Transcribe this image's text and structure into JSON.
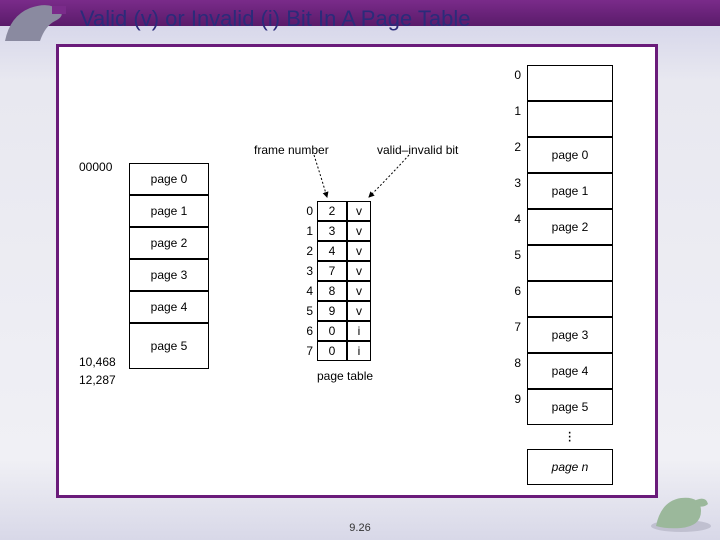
{
  "title": "Valid (v) or Invalid (i) Bit In A Page Table",
  "footer": "9.26",
  "labels": {
    "addr0": "00000",
    "addr1": "10,468",
    "addr2": "12,287",
    "frame_number": "frame number",
    "valid_invalid": "valid–invalid bit",
    "page_table": "page table"
  },
  "logical": [
    {
      "label": "page 0"
    },
    {
      "label": "page 1"
    },
    {
      "label": "page 2"
    },
    {
      "label": "page 3"
    },
    {
      "label": "page 4"
    },
    {
      "label": "page 5"
    }
  ],
  "pt": [
    {
      "idx": "0",
      "frame": "2",
      "bit": "v"
    },
    {
      "idx": "1",
      "frame": "3",
      "bit": "v"
    },
    {
      "idx": "2",
      "frame": "4",
      "bit": "v"
    },
    {
      "idx": "3",
      "frame": "7",
      "bit": "v"
    },
    {
      "idx": "4",
      "frame": "8",
      "bit": "v"
    },
    {
      "idx": "5",
      "frame": "9",
      "bit": "v"
    },
    {
      "idx": "6",
      "frame": "0",
      "bit": "i"
    },
    {
      "idx": "7",
      "frame": "0",
      "bit": "i"
    }
  ],
  "phys": [
    {
      "idx": "0",
      "label": ""
    },
    {
      "idx": "1",
      "label": ""
    },
    {
      "idx": "2",
      "label": "page 0"
    },
    {
      "idx": "3",
      "label": "page 1"
    },
    {
      "idx": "4",
      "label": "page 2"
    },
    {
      "idx": "5",
      "label": ""
    },
    {
      "idx": "6",
      "label": ""
    },
    {
      "idx": "7",
      "label": "page 3"
    },
    {
      "idx": "8",
      "label": "page 4"
    },
    {
      "idx": "9",
      "label": "page 5"
    }
  ],
  "phys_last": {
    "label": "page n"
  }
}
